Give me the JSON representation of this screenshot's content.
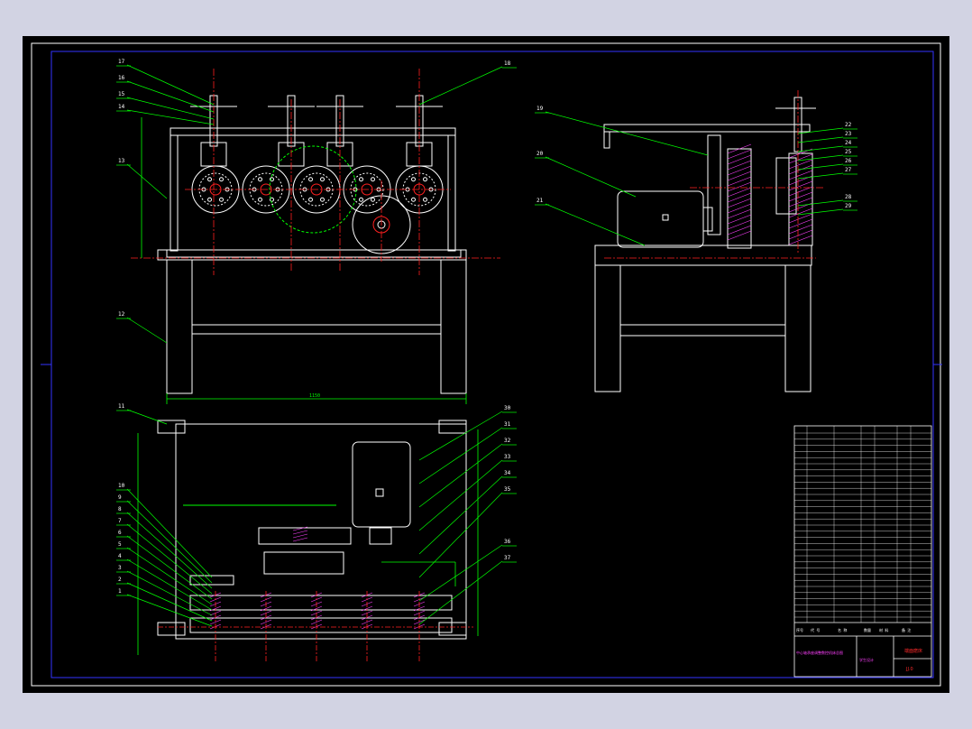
{
  "drawing": {
    "colors": {
      "background": "#000000",
      "outline": "#ffffff",
      "centerline": "#ff2020",
      "leader": "#00ff00",
      "hidden": "#ffff00",
      "hatch": "#ff40ff",
      "frame_outer": "#d2d3e3"
    },
    "front_view": {
      "part_labels": [
        "17",
        "16",
        "15",
        "14",
        "13",
        "12"
      ],
      "right_label": "18",
      "dimension_width": "1150"
    },
    "side_view": {
      "left_labels": [
        "19",
        "20",
        "21"
      ],
      "right_labels": [
        "22",
        "23",
        "24",
        "25",
        "26",
        "27",
        "28",
        "29"
      ]
    },
    "plan_view": {
      "top_left_label": "11",
      "left_labels": [
        "10",
        "9",
        "8",
        "7",
        "6",
        "5",
        "4",
        "3",
        "2",
        "1"
      ],
      "right_labels": [
        "30",
        "31",
        "32",
        "33",
        "34",
        "35",
        "36",
        "37"
      ]
    },
    "title_block": {
      "drawing_name": "端面磨床",
      "drawing_no": "JJ.0",
      "subtitle": "中心轴承座调整数控机床总图",
      "maker": "学生设计",
      "header_row": [
        "序号",
        "代 号",
        "名 称",
        "数量",
        "材 料",
        "备 注"
      ]
    }
  }
}
